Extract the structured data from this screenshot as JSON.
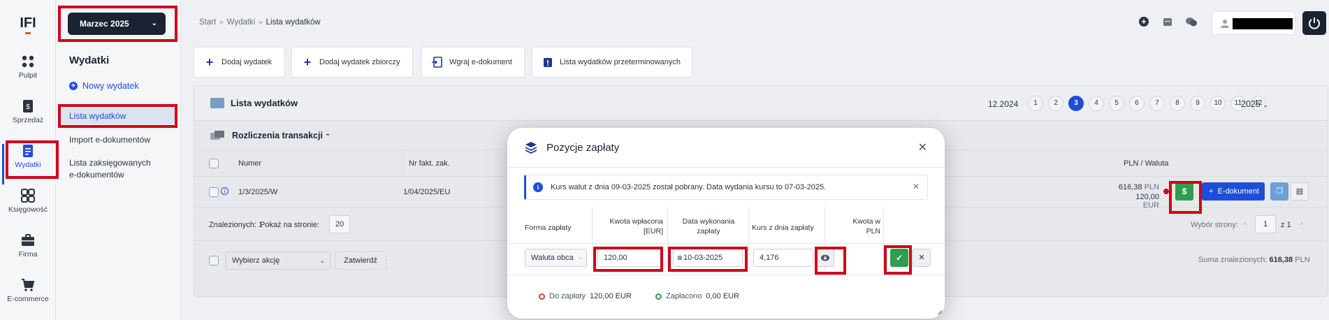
{
  "sidebar": {
    "items": [
      {
        "label": "Pulpit"
      },
      {
        "label": "Sprzedaż"
      },
      {
        "label": "Wydatki"
      },
      {
        "label": "Księgowość"
      },
      {
        "label": "Firma"
      },
      {
        "label": "E-commerce"
      }
    ]
  },
  "subnav": {
    "month": "Marzec 2025",
    "title": "Wydatki",
    "new_label": "Nowy wydatek",
    "links": [
      "Lista wydatków",
      "Import e-dokumentów",
      "Lista zaksięgowanych",
      "e-dokumentów"
    ]
  },
  "breadcrumb": {
    "a": "Start",
    "b": "Wydatki",
    "c": "Lista wydatków"
  },
  "actions": [
    "Dodaj wydatek",
    "Dodaj wydatek zbiorczy",
    "Wgraj e-dokument",
    "Lista wydatków przeterminowanych"
  ],
  "list": {
    "title": "Lista wydatków",
    "prev_period": "12.2024",
    "months": [
      "1",
      "2",
      "3",
      "4",
      "5",
      "6",
      "7",
      "8",
      "9",
      "10",
      "11",
      "12"
    ],
    "active_month": "3",
    "year": "2025",
    "section": "Rozliczenia transakcji",
    "col_numer": "Numer",
    "col_nrfakt": "Nr fakt. zak.",
    "col_pln": "PLN / Waluta",
    "row": {
      "numer": "1/3/2025/W",
      "nrfakt": "1/04/2025/EU",
      "pln": "616,38",
      "pln_cur": "PLN",
      "foreign": "120,00",
      "foreign_cur": "EUR"
    },
    "found_label": "Znalezionych:",
    "found": "1",
    "per_page_label": "Pokaż na stronie:",
    "per_page": "20",
    "page_select_label": "Wybór strony:",
    "page": "1",
    "of_label": "z",
    "pages": "1",
    "action_placeholder": "Wybierz akcję",
    "confirm": "Zatwierdź",
    "sum_label": "Suma znalezionych:",
    "sum": "616,38",
    "sum_cur": "PLN",
    "edoc_btn": "E-dokument",
    "dollar": "$"
  },
  "modal": {
    "title": "Pozycje zapłaty",
    "alert": "Kurs walut z dnia 09-03-2025 został pobrany. Data wydania kursu to 07-03-2025.",
    "h_forma": "Forma zapłaty",
    "h_kwota1": "Kwota wpłacona",
    "h_kwota2": "[EUR]",
    "h_data1": "Data wykonania",
    "h_data2": "zapłaty",
    "h_kurs": "Kurs z dnia zapłaty",
    "h_kpln1": "Kwota w",
    "h_kpln2": "PLN",
    "forma": "Waluta obca",
    "kwota": "120,00",
    "data": "10-03-2025",
    "kurs": "4,176",
    "do_zaplaty_label": "Do zapłaty",
    "do_zaplaty": "120,00 EUR",
    "zaplacono_label": "Zapłacono",
    "zaplacono": "0,00 EUR"
  },
  "colors": {
    "accent": "#1d4ed8",
    "dark": "#1b2333",
    "green": "#2f9e4f",
    "highlight": "#d0021b"
  }
}
